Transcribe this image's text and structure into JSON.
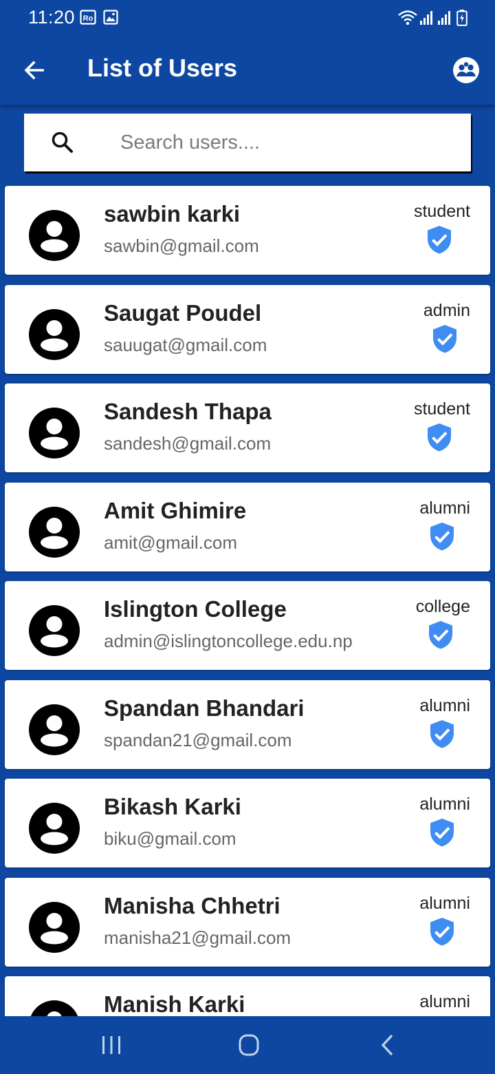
{
  "status_bar": {
    "time": "11:20"
  },
  "app_bar": {
    "title": "List of Users",
    "back_icon": "arrow-back-icon",
    "action_icon": "groups-icon"
  },
  "search": {
    "placeholder": "Search users....",
    "value": ""
  },
  "colors": {
    "primary": "#0d47a1",
    "verified_badge": "#3f8cf2",
    "card": "#ffffff"
  },
  "users": [
    {
      "name": "sawbin karki",
      "email": "sawbin@gmail.com",
      "role": "student"
    },
    {
      "name": "Saugat Poudel",
      "email": "sauugat@gmail.com",
      "role": "admin"
    },
    {
      "name": "Sandesh Thapa",
      "email": "sandesh@gmail.com",
      "role": "student"
    },
    {
      "name": "Amit Ghimire",
      "email": "amit@gmail.com",
      "role": "alumni"
    },
    {
      "name": "Islington College",
      "email": "admin@islingtoncollege.edu.np",
      "role": "college"
    },
    {
      "name": "Spandan Bhandari",
      "email": "spandan21@gmail.com",
      "role": "alumni"
    },
    {
      "name": "Bikash Karki",
      "email": "biku@gmail.com",
      "role": "alumni"
    },
    {
      "name": "Manisha Chhetri",
      "email": "manisha21@gmail.com",
      "role": "alumni"
    },
    {
      "name": "Manish Karki",
      "email": "",
      "role": "alumni"
    }
  ],
  "nav_bar": {
    "recents_icon": "recents-icon",
    "home_icon": "home-icon",
    "back_icon": "nav-back-icon"
  }
}
